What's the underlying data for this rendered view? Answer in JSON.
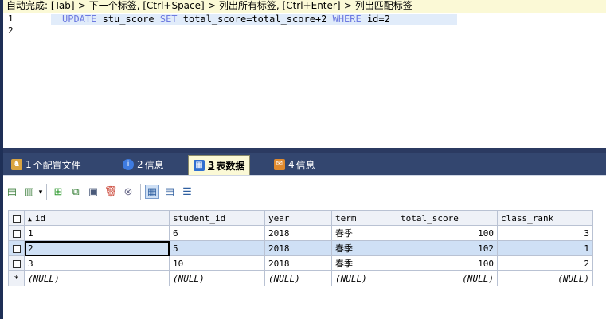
{
  "hint": "自动完成: [Tab]-> 下一个标签, [Ctrl+Space]-> 列出所有标签, [Ctrl+Enter]-> 列出匹配标签",
  "editor": {
    "line_numbers": [
      "1",
      "2"
    ],
    "sql": {
      "kw_update": "UPDATE",
      "table": " stu_score ",
      "kw_set": "SET",
      "assign": " total_score=total_score+2 ",
      "kw_where": "WHERE",
      "cond": " id=2"
    }
  },
  "tabs": [
    {
      "num": "1",
      "label": "个配置文件",
      "icon": "profile-icon",
      "color": "#d9a441"
    },
    {
      "num": "2",
      "label": "信息",
      "icon": "info-icon",
      "color": "#3e7be0"
    },
    {
      "num": "3",
      "label": "表数据",
      "icon": "table-data-icon",
      "color": "#2f6fd0"
    },
    {
      "num": "4",
      "label": "信息",
      "icon": "info-message-icon",
      "color": "#e08a2e"
    }
  ],
  "toolbar_icons": [
    "export-icon",
    "import-icon",
    "add-row-icon",
    "duplicate-row-icon",
    "save-icon",
    "delete-icon",
    "discard-icon",
    "grid-view-icon",
    "form-view-icon",
    "text-view-icon"
  ],
  "grid": {
    "columns": [
      "id",
      "student_id",
      "year",
      "term",
      "total_score",
      "class_rank"
    ],
    "rows": [
      [
        "1",
        "6",
        "2018",
        "春季",
        "100",
        "3"
      ],
      [
        "2",
        "5",
        "2018",
        "春季",
        "102",
        "1"
      ],
      [
        "3",
        "10",
        "2018",
        "春季",
        "100",
        "2"
      ]
    ],
    "new_row_marker": "*",
    "null_label": "(NULL)"
  }
}
